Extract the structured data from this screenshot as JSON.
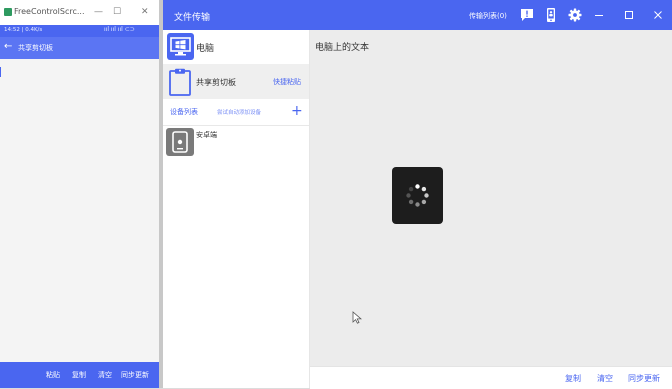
{
  "phone_window": {
    "title": "FreeControlScrc...",
    "controls": {
      "minimize": "—",
      "maximize": "☐",
      "close": "✕"
    },
    "status_bar": {
      "time_speed": "14:52 | 0.4K/s",
      "icons": "ııl ııl ııl ⊂⊃"
    },
    "app_bar": {
      "back_icon": "←",
      "title": "共享剪切板"
    },
    "bottom_bar": {
      "paste": "粘贴",
      "copy": "复制",
      "clear": "清空",
      "sync": "同步更新"
    }
  },
  "main_window": {
    "title": "文件传输",
    "transfer_list": "传输列表(0)",
    "icons": {
      "message": "message-icon",
      "phone": "phone-icon",
      "settings": "gear-icon"
    },
    "sidebar": {
      "pc_label": "电脑",
      "clipboard_label": "共享剪切板",
      "quick_paste": "快捷粘贴",
      "device_list_label": "设备列表",
      "auto_add_label": "尝试自动添加设备",
      "add_icon": "+",
      "devices": [
        {
          "name": "安卓端"
        }
      ]
    },
    "main": {
      "heading": "电脑上的文本",
      "footer": {
        "copy": "复制",
        "clear": "清空",
        "sync": "同步更新"
      }
    }
  },
  "colors": {
    "accent": "#4a66f0",
    "spinner_bg": "#1d1d1d"
  }
}
